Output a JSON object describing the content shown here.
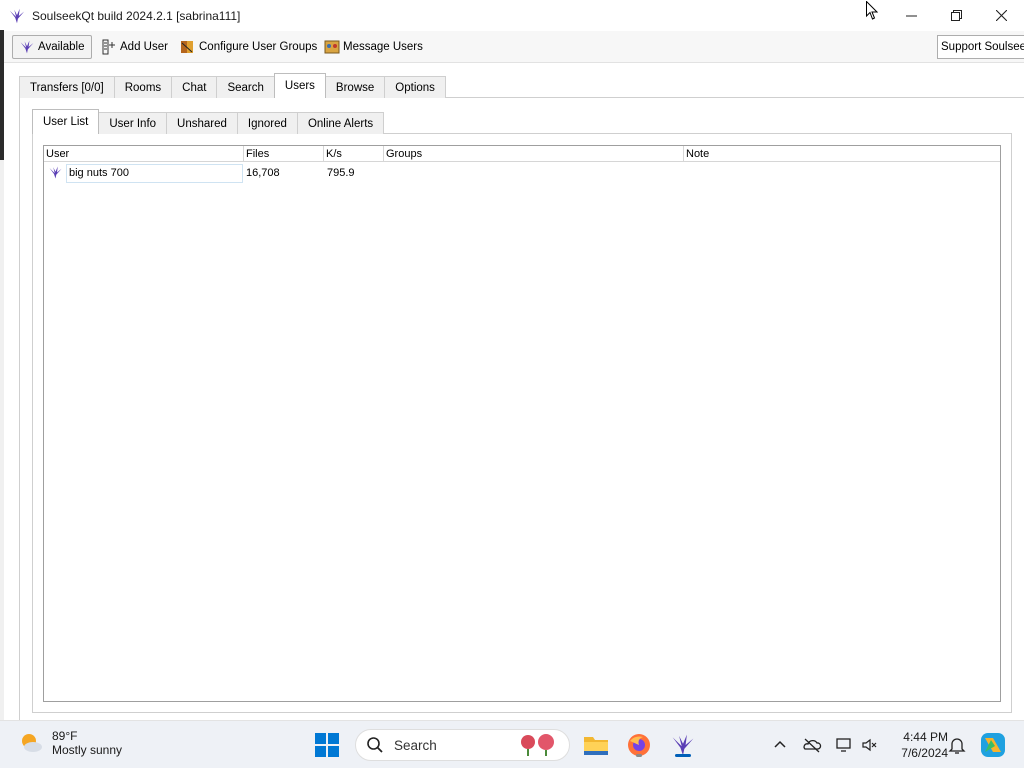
{
  "window": {
    "title": "SoulseekQt build 2024.2.1 [sabrina111]"
  },
  "toolbar": {
    "status_label": "Available",
    "add_user_label": "Add User",
    "configure_groups_label": "Configure User Groups",
    "message_users_label": "Message Users",
    "support_label": "Support Soulseek"
  },
  "main_tabs": [
    {
      "label": "Transfers [0/0]"
    },
    {
      "label": "Rooms"
    },
    {
      "label": "Chat"
    },
    {
      "label": "Search"
    },
    {
      "label": "Users"
    },
    {
      "label": "Browse"
    },
    {
      "label": "Options"
    }
  ],
  "active_main_tab": "Users",
  "sub_tabs": [
    {
      "label": "User List"
    },
    {
      "label": "User Info"
    },
    {
      "label": "Unshared"
    },
    {
      "label": "Ignored"
    },
    {
      "label": "Online Alerts"
    }
  ],
  "active_sub_tab": "User List",
  "table": {
    "columns": [
      "User",
      "Files",
      "K/s",
      "Groups",
      "Note"
    ],
    "rows": [
      {
        "user": "big nuts 700",
        "files": "16,708",
        "speed": "795.9",
        "groups": "",
        "note": ""
      }
    ]
  },
  "taskbar": {
    "weather_temp": "89°F",
    "weather_condition": "Mostly sunny",
    "search_label": "Search",
    "time": "4:44 PM",
    "date": "7/6/2024"
  },
  "colors": {
    "accent": "#005fb8",
    "soulseek_bird": "#5b3fb5"
  }
}
